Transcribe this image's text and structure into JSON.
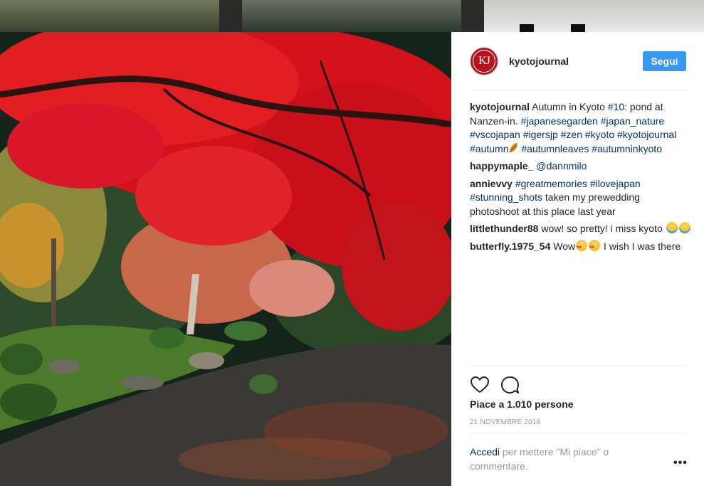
{
  "post": {
    "username": "kyotojournal",
    "avatar_text": "KJ",
    "follow_label": "Segui",
    "caption": {
      "user": "kyotojournal",
      "text_1": " Autumn in Kyoto ",
      "tag_1": "#10",
      "text_2": ": pond at Nanzen-in. ",
      "tags_line": "#japanesegarden #japan_nature #vscojapan #igersjp #zen #kyoto #kyotojournal #autumn",
      "tags_tail": " #autumnleaves #autumninkyoto"
    },
    "comments": [
      {
        "user": "happymaple_",
        "mention": " @dannmilo"
      },
      {
        "user": "annievvy",
        "tags": " #greatmemories #ilovejapan #stunning_shots",
        "text": " taken my prewedding photoshoot at this place last year"
      },
      {
        "user": "littlethunder88",
        "text": " wow! so pretty! i miss kyoto "
      },
      {
        "user": "butterfly.1975_54",
        "text_1": " Wow",
        "text_2": " I wish I was there"
      }
    ],
    "likes": "Piace a 1.010 persone",
    "date": "21 NOVEMBRE 2016",
    "login_link": "Accedi",
    "login_text": " per mettere \"Mi piace\" o commentare.",
    "more_label": "•••"
  },
  "icons": [
    "heart-icon",
    "comment-icon",
    "more-options-icon"
  ],
  "colors": {
    "follow_button": "#3897f0",
    "link": "#003569",
    "avatar": "#b5121b"
  }
}
